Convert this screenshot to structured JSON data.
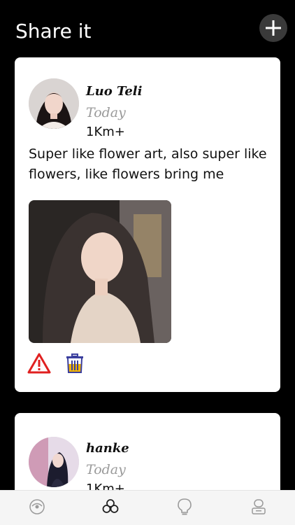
{
  "header": {
    "title": "Share it",
    "add_icon": "plus-icon"
  },
  "posts": [
    {
      "username": "Luo Teli",
      "date": "Today",
      "distance": "1Km+",
      "text": "Super like flower art, also super like flowers, like flowers bring me",
      "avatar_icon": "avatar-photo",
      "photo_icon": "post-photo",
      "actions": [
        "warning-icon",
        "trash-icon"
      ]
    },
    {
      "username": "hanke",
      "date": "Today",
      "distance": "1Km+"
    }
  ],
  "tabbar": {
    "tabs": [
      "eye-icon",
      "clover-icon",
      "lightbulb-icon",
      "profile-icon"
    ],
    "active_index": 1
  },
  "colors": {
    "background": "#000000",
    "card": "#ffffff",
    "warning": "#e02020",
    "trash_stroke": "#3b3f9e",
    "trash_fill": "#f2b400"
  }
}
